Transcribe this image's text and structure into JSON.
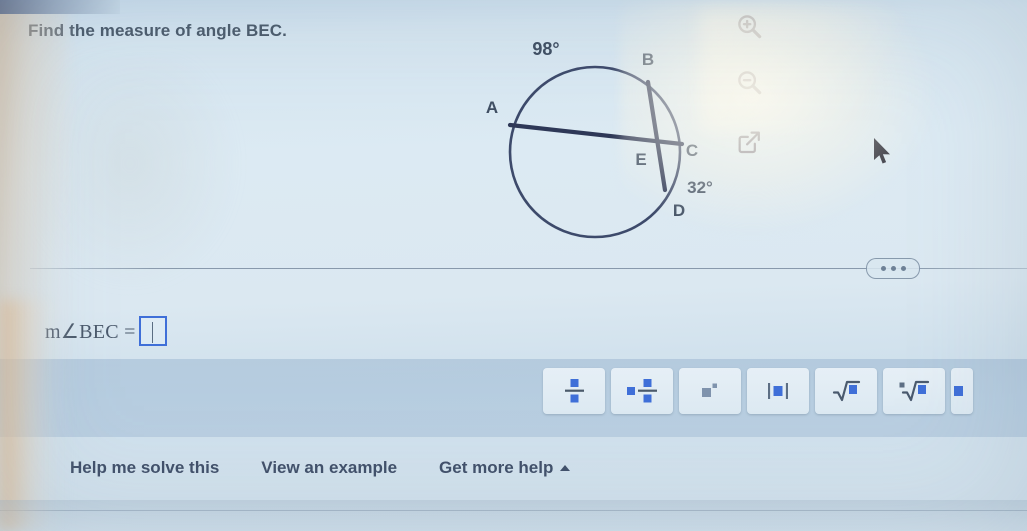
{
  "question": {
    "prompt": "Find the measure of angle BEC."
  },
  "figure": {
    "type": "circle-with-intersecting-chords",
    "points": [
      {
        "label": "A",
        "role": "chord-endpoint"
      },
      {
        "label": "B",
        "role": "chord-endpoint"
      },
      {
        "label": "C",
        "role": "chord-endpoint"
      },
      {
        "label": "D",
        "role": "chord-endpoint"
      },
      {
        "label": "E",
        "role": "intersection"
      }
    ],
    "arc_labels": [
      {
        "text": "98°",
        "arc": "AB"
      },
      {
        "text": "32°",
        "arc": "CD"
      }
    ],
    "chords": [
      "AC",
      "BD"
    ],
    "stroke_color": "#3d4a6b"
  },
  "toolbar": {
    "zoom_in_icon": "magnifier-plus-icon",
    "zoom_out_icon": "magnifier-minus-icon",
    "popout_icon": "external-link-icon"
  },
  "divider": {
    "handle_icon": "three-dots-handle"
  },
  "answer": {
    "label": "m∠BEC =",
    "value": "",
    "placeholder": ""
  },
  "math_keypad": {
    "keys": [
      {
        "name": "fraction-key",
        "label": "fraction"
      },
      {
        "name": "mixed-number-key",
        "label": "mixed number"
      },
      {
        "name": "exponent-key",
        "label": "exponent"
      },
      {
        "name": "absolute-value-key",
        "label": "absolute value"
      },
      {
        "name": "square-root-key",
        "label": "square root"
      },
      {
        "name": "nth-root-key",
        "label": "nth root"
      },
      {
        "name": "more-keys",
        "label": "more"
      }
    ]
  },
  "help": {
    "solve_label": "Help me solve this",
    "example_label": "View an example",
    "more_help_label": "Get more help",
    "more_help_caret": "caret-up-icon"
  },
  "colors": {
    "accent_blue": "#3f6fd8",
    "text": "#4a5a6b",
    "figure_stroke": "#3d4a6b",
    "page_bg": "#dceaf3"
  }
}
